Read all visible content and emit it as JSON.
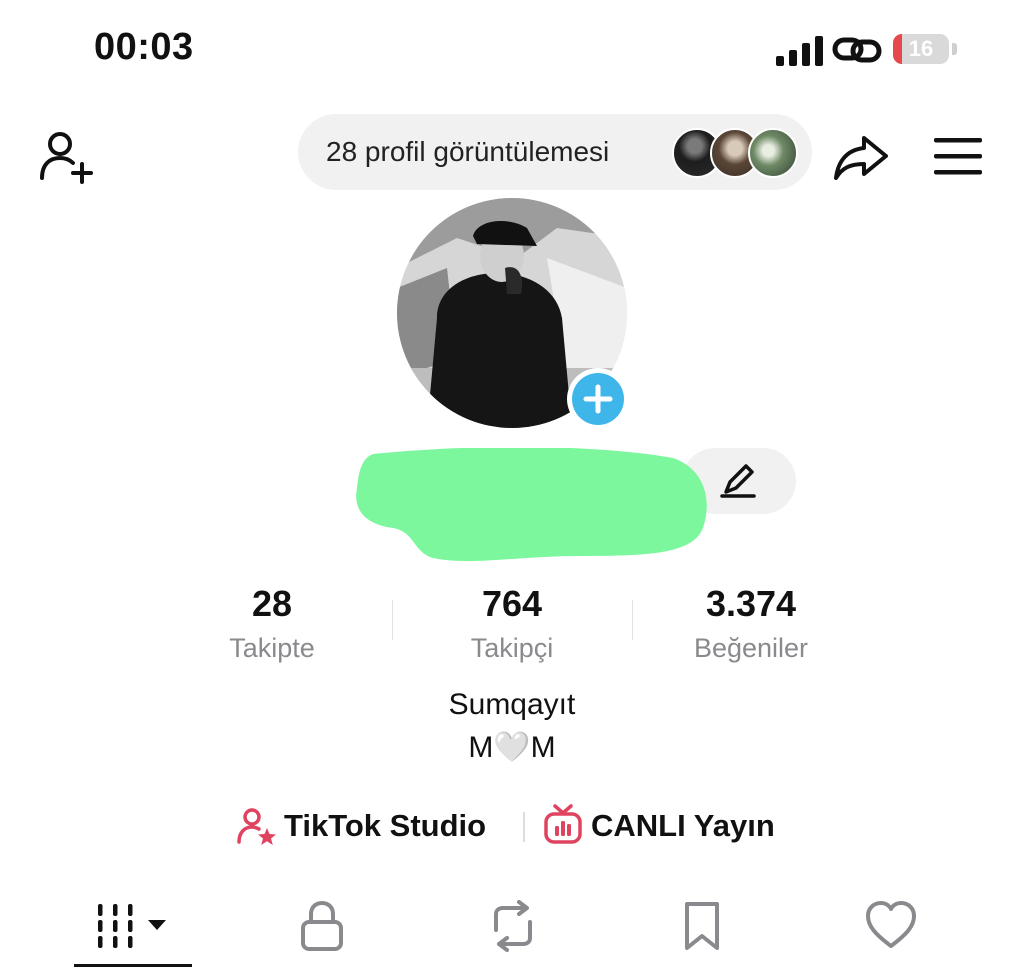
{
  "status_bar": {
    "time": "00:03",
    "battery_level": 16,
    "battery_label": "16",
    "battery_color": "#e5484d"
  },
  "header": {
    "profile_views_label": "28 profil görüntülemesi",
    "viewer_avatars": [
      "viewer-avatar-1",
      "viewer-avatar-2",
      "viewer-avatar-3"
    ]
  },
  "profile": {
    "avatar_add_color": "#3fb6ea",
    "name_redaction_color": "#7cf79d",
    "stats": [
      {
        "value": "28",
        "label": "Takipte"
      },
      {
        "value": "764",
        "label": "Takipçi"
      },
      {
        "value": "3.374",
        "label": "Beğeniler"
      }
    ],
    "bio": [
      "Sumqayıt",
      "M🤍M"
    ]
  },
  "links": {
    "studio": "TikTok Studio",
    "live": "CANLI Yayın",
    "icon_color": "#e0435f"
  },
  "tabs": [
    {
      "name": "videos",
      "icon": "grid-icon",
      "active": true
    },
    {
      "name": "private",
      "icon": "lock-icon",
      "active": false
    },
    {
      "name": "reposts",
      "icon": "repost-icon",
      "active": false
    },
    {
      "name": "favorites",
      "icon": "bookmark-icon",
      "active": false
    },
    {
      "name": "liked",
      "icon": "heart-icon",
      "active": false
    }
  ]
}
